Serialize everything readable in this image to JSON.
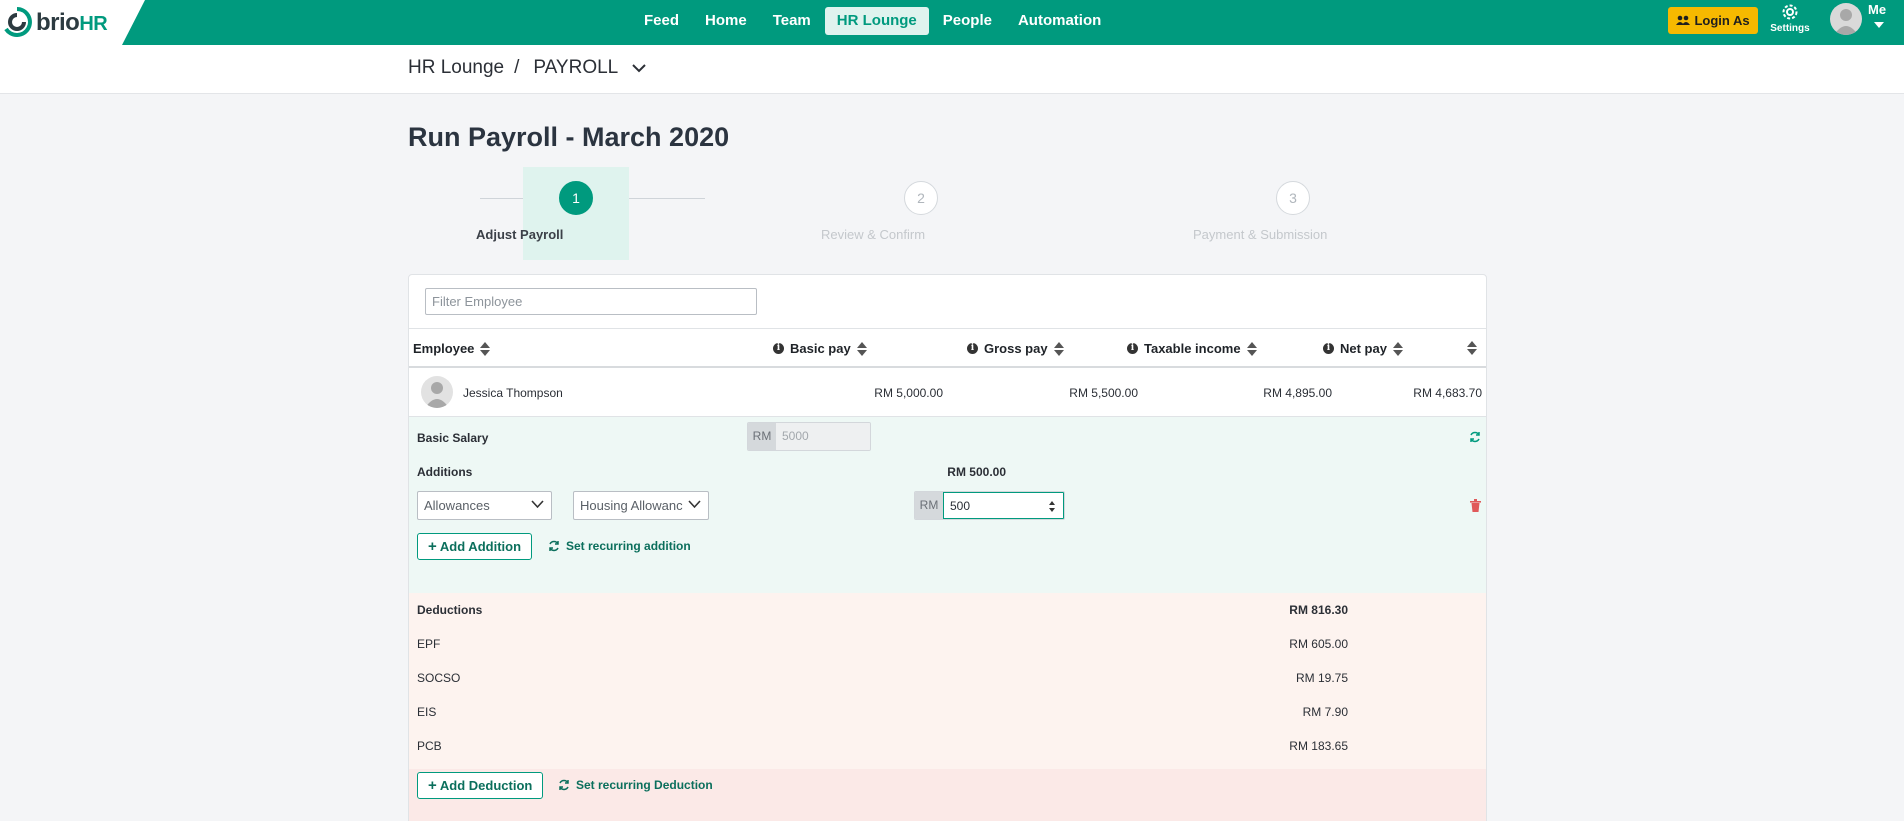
{
  "brand": {
    "name_main": "brio",
    "name_accent": "HR"
  },
  "nav": {
    "items": [
      {
        "label": "Feed"
      },
      {
        "label": "Home"
      },
      {
        "label": "Team"
      },
      {
        "label": "HR Lounge"
      },
      {
        "label": "People"
      },
      {
        "label": "Automation"
      }
    ],
    "active": "HR Lounge",
    "login_as_label": "Login As",
    "settings_label": "Settings",
    "user_label": "Me"
  },
  "breadcrumb": {
    "parent": "HR Lounge",
    "separator": "/",
    "current": "PAYROLL"
  },
  "page_title": "Run Payroll - March 2020",
  "stepper": [
    {
      "number": "1",
      "label": "Adjust Payroll",
      "active": true
    },
    {
      "number": "2",
      "label": "Review & Confirm",
      "active": false
    },
    {
      "number": "3",
      "label": "Payment & Submission",
      "active": false
    }
  ],
  "filter": {
    "placeholder": "Filter Employee",
    "value": ""
  },
  "table": {
    "headers": {
      "employee": "Employee",
      "basic_pay": "Basic pay",
      "gross_pay": "Gross pay",
      "taxable_income": "Taxable income",
      "net_pay": "Net pay"
    },
    "row": {
      "name": "Jessica Thompson",
      "basic_pay": "RM 5,000.00",
      "gross_pay": "RM 5,500.00",
      "taxable_income": "RM 4,895.00",
      "net_pay": "RM 4,683.70"
    }
  },
  "details": {
    "basic_salary": {
      "label": "Basic Salary",
      "prefix": "RM",
      "value": "5000"
    },
    "additions": {
      "label": "Additions",
      "total": "RM 500.00",
      "item": {
        "category": "Allowances",
        "type": "Housing Allowanc",
        "prefix": "RM",
        "amount": "500"
      },
      "add_label": "Add Addition",
      "recurring_label": "Set recurring addition"
    },
    "deductions": {
      "label": "Deductions",
      "total": "RM 816.30",
      "items": [
        {
          "name": "EPF",
          "amount": "RM 605.00"
        },
        {
          "name": "SOCSO",
          "amount": "RM 19.75"
        },
        {
          "name": "EIS",
          "amount": "RM 7.90"
        },
        {
          "name": "PCB",
          "amount": "RM 183.65"
        }
      ],
      "add_label": "Add Deduction",
      "recurring_label": "Set recurring Deduction"
    }
  },
  "colors": {
    "brand": "#009a7e",
    "login_button": "#f6b900",
    "addition_bg": "#eef8f5",
    "deduction_bg": "#fdf3ef",
    "delete": "#e05a5a"
  }
}
